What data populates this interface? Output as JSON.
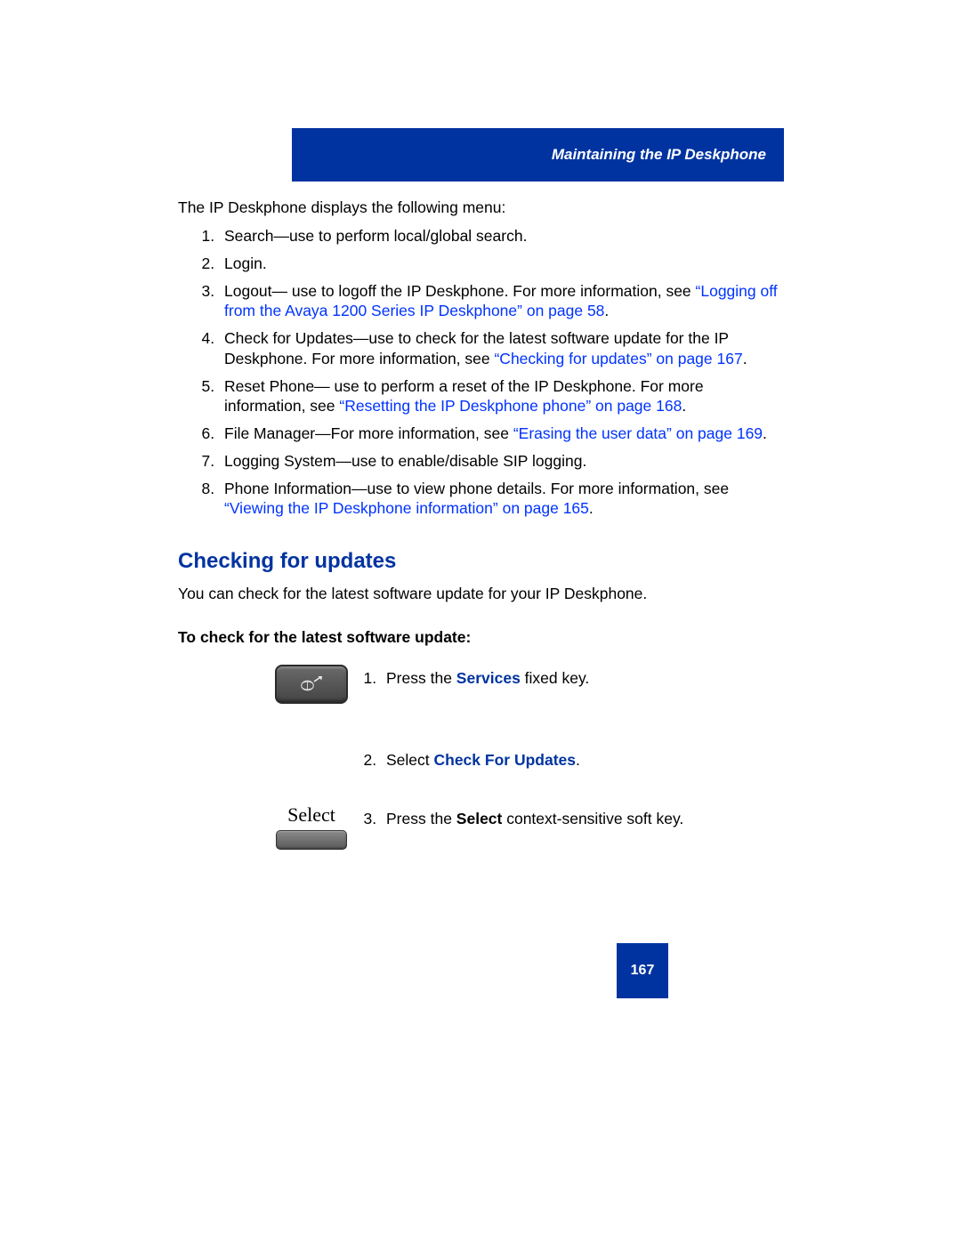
{
  "header": {
    "title": "Maintaining the IP Deskphone"
  },
  "intro": "The IP Deskphone displays the following menu:",
  "menu_items": {
    "i1": "Search—use to perform local/global search.",
    "i2": "Login.",
    "i3a": "Logout— use to logoff the IP Deskphone. For more information, see ",
    "i3link": "“Logging off from the Avaya 1200 Series IP Deskphone” on page 58",
    "i3b": ".",
    "i4a": "Check for Updates—use to check for the latest software update for the IP Deskphone. For more information, see ",
    "i4link": "“Checking for updates” on page 167",
    "i4b": ".",
    "i5a": "Reset Phone— use to perform a reset of the IP Deskphone. For more information, see ",
    "i5link": "“Resetting the IP Deskphone phone” on page 168",
    "i5b": ".",
    "i6a": "File Manager—For more information, see ",
    "i6link": "“Erasing the user data” on page 169",
    "i6b": ".",
    "i7": "Logging System—use to enable/disable SIP logging.",
    "i8a": "Phone Information—use to view phone details. For more information, see ",
    "i8link": "“Viewing the IP Deskphone information” on page 165",
    "i8b": "."
  },
  "section": {
    "heading": "Checking for updates",
    "description": "You can check for the latest software update for your IP Deskphone.",
    "subheading": "To check for the latest software update:"
  },
  "steps": {
    "s1a": "Press the ",
    "s1b": "Services",
    "s1c": " fixed key.",
    "s2a": "Select ",
    "s2b": "Check For Updates",
    "s2c": ".",
    "s3a": "Press the ",
    "s3b": "Select",
    "s3c": " context-sensitive soft key.",
    "select_label": "Select"
  },
  "page_number": "167"
}
